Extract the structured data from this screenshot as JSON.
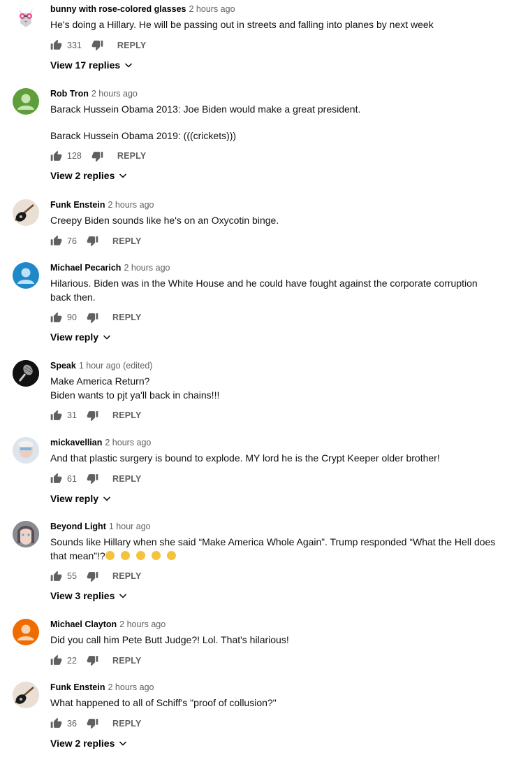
{
  "comments": [
    {
      "author": "bunny with rose-colored glasses",
      "time": "2 hours ago",
      "lines": [
        "He's doing a Hillary. He will be passing out in streets and falling into planes by next week"
      ],
      "likes": "331",
      "reply_label": "REPLY",
      "view_replies": "View 17 replies",
      "avatar_icon": "cat-glasses-avatar"
    },
    {
      "author": "Rob Tron",
      "time": "2 hours ago",
      "lines": [
        "Barack Hussein Obama 2013: Joe Biden would make a great president.",
        "Barack Hussein Obama 2019: (((crickets)))"
      ],
      "likes": "128",
      "reply_label": "REPLY",
      "view_replies": "View 2 replies",
      "avatar_color": "#5e9e3b"
    },
    {
      "author": "Funk Enstein",
      "time": "2 hours ago",
      "lines": [
        "Creepy Biden sounds like he's on an Oxycotin binge."
      ],
      "likes": "76",
      "reply_label": "REPLY",
      "avatar_icon": "guitar-avatar"
    },
    {
      "author": "Michael Pecarich",
      "time": "2 hours ago",
      "lines": [
        "Hilarious. Biden was in the White House and he could have fought against the corporate corruption back then."
      ],
      "likes": "90",
      "reply_label": "REPLY",
      "view_replies": "View reply",
      "avatar_color": "#1e88c9"
    },
    {
      "author": "Speak",
      "time": "1 hour ago (edited)",
      "lines": [
        "Make America Return?",
        "Biden wants to pjt ya'll back in chains!!!"
      ],
      "likes": "31",
      "reply_label": "REPLY",
      "avatar_icon": "microphone-avatar"
    },
    {
      "author": "mickavellian",
      "time": "2 hours ago",
      "lines": [
        "And that plastic  surgery is bound to explode. MY lord he is the Crypt Keeper older brother!"
      ],
      "likes": "61",
      "reply_label": "REPLY",
      "view_replies": "View reply",
      "avatar_icon": "face-photo-avatar"
    },
    {
      "author": "Beyond Light",
      "time": "1 hour ago",
      "lines": [
        "Sounds like Hillary when she said “Make America Whole Again”. Trump responded “What the Hell does that mean”!?"
      ],
      "likes": "55",
      "reply_label": "REPLY",
      "view_replies": "View 3 replies",
      "avatar_icon": "woman-photo-avatar"
    },
    {
      "author": "Michael Clayton",
      "time": "2 hours ago",
      "lines": [
        "Did you call him Pete Butt Judge?! Lol. That's hilarious!"
      ],
      "likes": "22",
      "reply_label": "REPLY",
      "avatar_color": "#ef6c00"
    },
    {
      "author": "Funk Enstein",
      "time": "2 hours ago",
      "lines": [
        "What happened to all of Schiff's \"proof of collusion?\""
      ],
      "likes": "36",
      "reply_label": "REPLY",
      "view_replies": "View 2 replies",
      "avatar_icon": "guitar-avatar"
    }
  ]
}
